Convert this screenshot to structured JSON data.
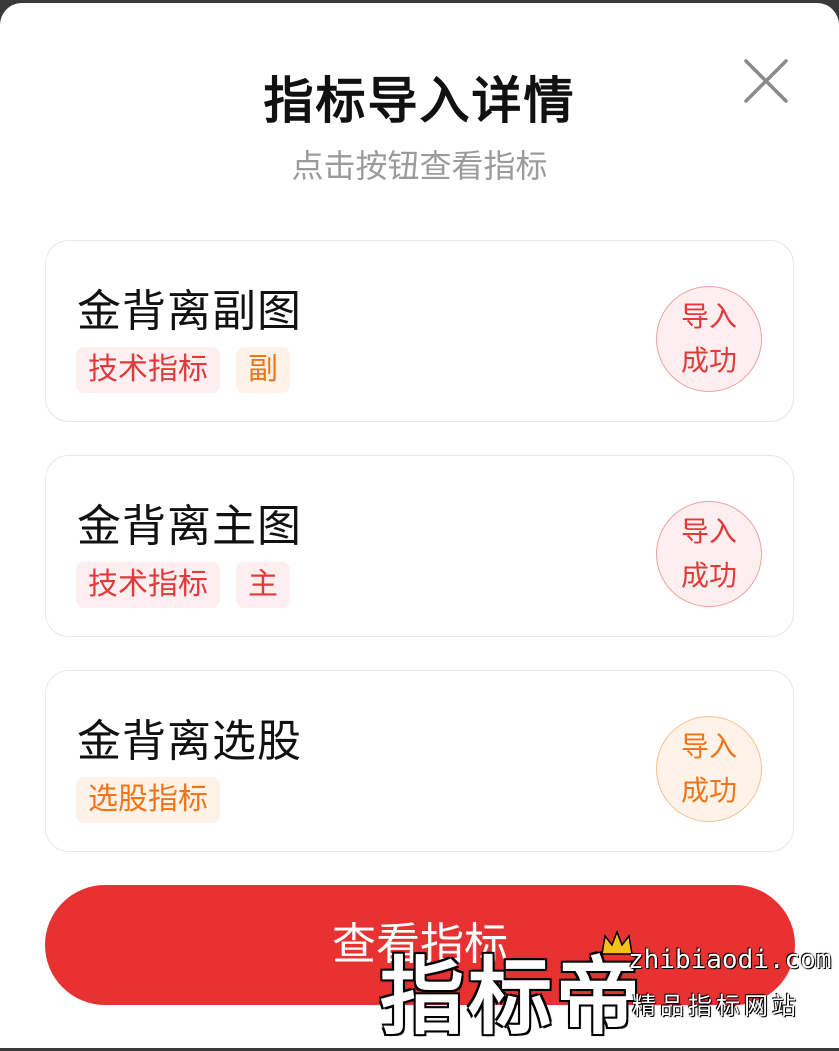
{
  "modal": {
    "title": "指标导入详情",
    "subtitle": "点击按钮查看指标"
  },
  "indicators": [
    {
      "name": "金背离副图",
      "tags": [
        {
          "label": "技术指标",
          "color": "#e23a3a"
        },
        {
          "label": "副",
          "color": "#f07418"
        }
      ],
      "status_line1": "导入",
      "status_line2": "成功",
      "status_color": "#e23a3a"
    },
    {
      "name": "金背离主图",
      "tags": [
        {
          "label": "技术指标",
          "color": "#e23a3a"
        },
        {
          "label": "主",
          "color": "#e23a3a"
        }
      ],
      "status_line1": "导入",
      "status_line2": "成功",
      "status_color": "#e23a3a"
    },
    {
      "name": "金背离选股",
      "tags": [
        {
          "label": "选股指标",
          "color": "#f07418"
        }
      ],
      "status_line1": "导入",
      "status_line2": "成功",
      "status_color": "#f07418"
    }
  ],
  "actions": {
    "view_button": "查看指标"
  },
  "watermark": {
    "brand": "指标帝",
    "url": "zhibiaodi.com",
    "tagline": "精品指标网站"
  },
  "colors": {
    "primary": "#e83232",
    "accent_orange": "#f07418"
  }
}
